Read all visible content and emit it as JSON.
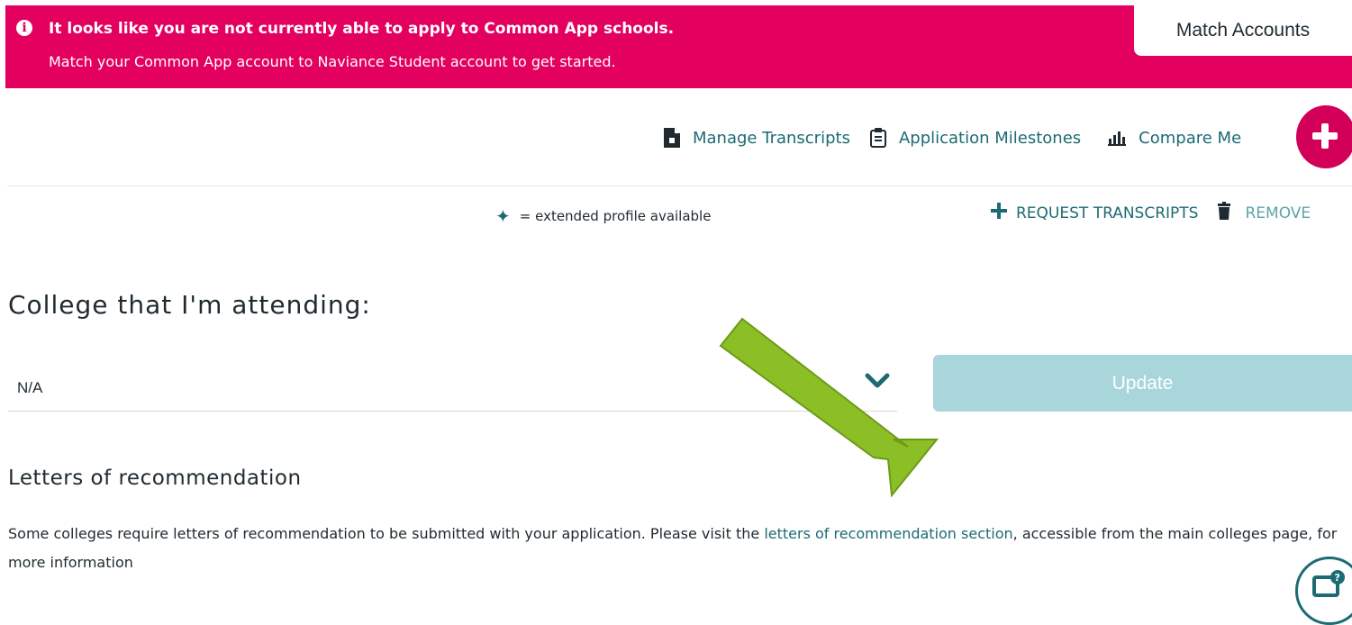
{
  "banner": {
    "title": "It looks like you are not currently able to apply to Common App schools.",
    "message": "Match your Common App account to Naviance Student account to get started.",
    "button_label": "Match Accounts",
    "icon": "info-circle-icon",
    "color": "#e3005f"
  },
  "toolbar": {
    "manage_transcripts": "Manage Transcripts",
    "application_milestones": "Application Milestones",
    "compare_me": "Compare Me",
    "fab_icon": "plus-icon"
  },
  "legend": {
    "symbol": "✦",
    "label": "= extended profile available"
  },
  "actions": {
    "request": "REQUEST TRANSCRIPTS",
    "remove": "REMOVE"
  },
  "college": {
    "heading": "College that I'm attending:",
    "selected": "N/A",
    "update_label": "Update"
  },
  "recommendations": {
    "heading": "Letters of recommendation",
    "text_before": "Some colleges require letters of recommendation to be submitted with your application. Please visit the ",
    "link": "letters of recommendation section",
    "text_after": ", accessible from the main colleges page, for more information"
  },
  "colors": {
    "accent": "#1c6b74",
    "fab": "#d3005a",
    "update_disabled": "#a8d6db",
    "annotation_arrow": "#8cbf26"
  }
}
